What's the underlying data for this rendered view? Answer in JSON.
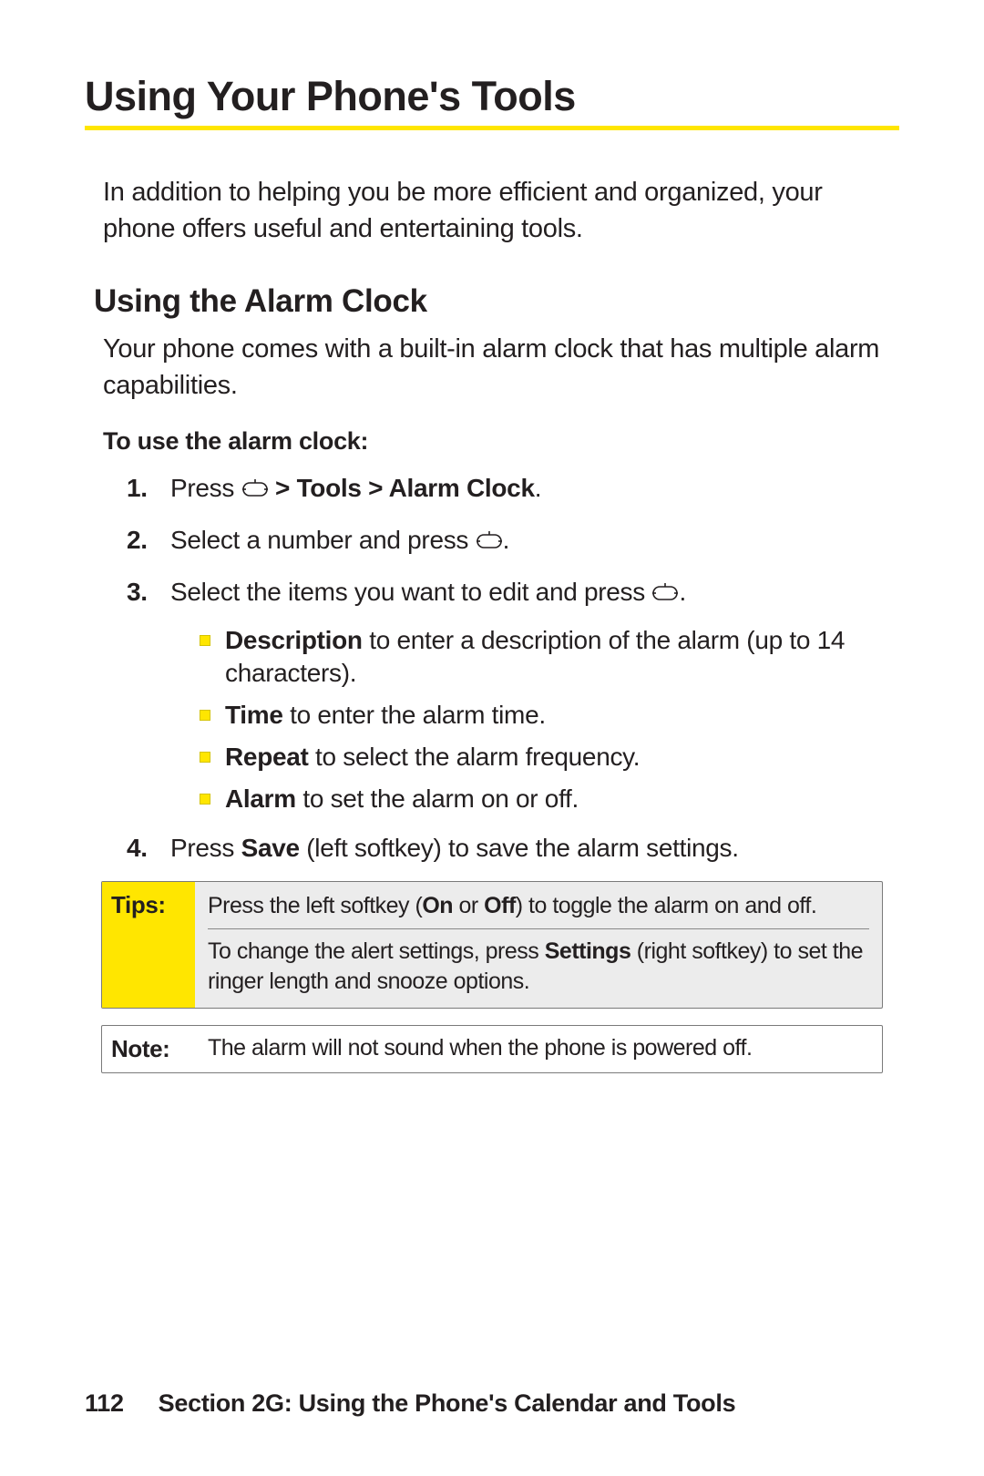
{
  "title": "Using Your Phone's Tools",
  "intro": "In addition to helping you be more efficient and organized, your phone offers useful and entertaining tools.",
  "section": {
    "heading": "Using the Alarm Clock",
    "intro": "Your phone comes with a built-in alarm clock that has multiple alarm capabilities.",
    "lead": "To use the alarm clock:",
    "step1_a": "Press ",
    "step1_b": " > Tools > Alarm Clock",
    "step1_c": ".",
    "step2_a": "Select a number and press ",
    "step2_b": ".",
    "step3_a": "Select the items you want to edit and press ",
    "step3_b": ".",
    "bul1_b": "Description",
    "bul1_t": " to enter a description of the alarm (up to 14 characters).",
    "bul2_b": "Time",
    "bul2_t": " to enter the alarm time.",
    "bul3_b": "Repeat",
    "bul3_t": " to select the alarm frequency.",
    "bul4_b": "Alarm",
    "bul4_t": " to set the alarm on or off.",
    "step4_a": "Press ",
    "step4_b": "Save",
    "step4_c": " (left softkey) to save the alarm settings."
  },
  "tips": {
    "label": "Tips:",
    "row1_a": "Press the left softkey (",
    "row1_b": "On",
    "row1_c": " or ",
    "row1_d": "Off",
    "row1_e": ") to toggle the alarm on and off.",
    "row2_a": "To change the alert settings, press ",
    "row2_b": "Settings",
    "row2_c": " (right softkey) to set the ringer length and snooze options."
  },
  "note": {
    "label": "Note:",
    "text": "The alarm will not sound when the phone is powered off."
  },
  "footer": {
    "page": "112",
    "text": "Section 2G: Using the Phone's Calendar and Tools"
  }
}
